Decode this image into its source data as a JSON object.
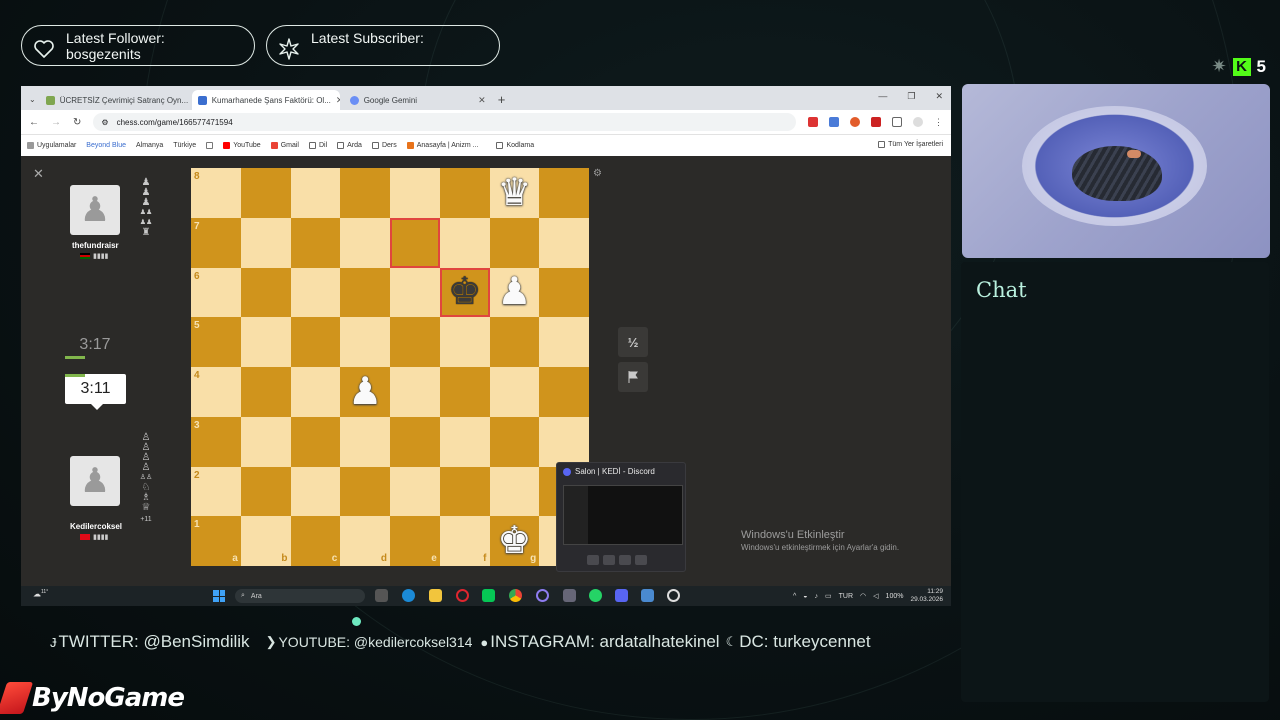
{
  "overlay": {
    "follower_label": "Latest Follower:",
    "follower_name": "bosgezenits",
    "subscriber_label": "Latest Subscriber:",
    "subscriber_name": "",
    "kick_count": "5",
    "chat_title": "Chat",
    "socials": [
      {
        "icon": "twitter-icon",
        "text": "TWITTER: @BenSimdilik"
      },
      {
        "icon": "youtube-icon",
        "text": "YOUTUBE: @kedilercoksel314"
      },
      {
        "icon": "instagram-icon",
        "text": "INSTAGRAM: ardatalhatekinel"
      },
      {
        "icon": "discord-icon",
        "text": "DC: turkeycennet"
      }
    ],
    "sponsor": "ByNoGame",
    "colors": {
      "accent": "#b9f0de",
      "kick_green": "#53fc18",
      "bynogame_red": "#e0261f"
    }
  },
  "browser": {
    "tabs": [
      {
        "label": "ÜCRETSİZ Çevrimiçi Satranç Oyn...",
        "active": false,
        "fav_color": "#7fa650"
      },
      {
        "label": "Kumarhanede Şans Faktörü: Ol...",
        "active": true,
        "fav_color": "#3b6ecf"
      },
      {
        "label": "Google Gemini",
        "active": false,
        "fav_color": "#6a8ef5"
      }
    ],
    "url": "chess.com/game/166577471594",
    "bookmarks": [
      "Uygulamalar",
      "Beyond Blue",
      "Almanya",
      "Türkiye",
      "YouTube",
      "Gmail",
      "Dil",
      "Arda",
      "Ders",
      "Anasayfa | Anizm ...",
      "Kodlama"
    ],
    "bookmarks_right": "Tüm Yer İşaretleri"
  },
  "chess": {
    "top_player": {
      "name": "thefundraisr",
      "rating": "▮▮▮▮",
      "clock": "3:17",
      "captured": [
        "♟",
        "♟",
        "♟",
        "♟♟",
        "♟♟",
        "♜"
      ]
    },
    "bottom_player": {
      "name": "Kedilercoksel",
      "rating": "▮▮▮▮",
      "clock": "3:11",
      "captured": [
        "♙",
        "♙",
        "♙",
        "♙",
        "♙♙",
        "♘",
        "♗",
        "♕"
      ],
      "advantage": "+11"
    },
    "ranks": [
      "8",
      "7",
      "6",
      "5",
      "4",
      "3",
      "2",
      "1"
    ],
    "files": [
      "a",
      "b",
      "c",
      "d",
      "e",
      "f",
      "g",
      "h"
    ],
    "pieces": {
      "g8": "♕w",
      "f6": "♚b",
      "g6": "♙w",
      "d4": "♙w",
      "g1": "♔w"
    },
    "highlights": [
      "e7",
      "f6"
    ],
    "draw_button": "½",
    "resign_icon": "flag-icon"
  },
  "discord_popup": {
    "title": "Salon | KEDİ - Discord"
  },
  "windows": {
    "activation_title": "Windows'u Etkinleştir",
    "activation_sub": "Windows'u etkinleştirmek için Ayarlar'a gidin.",
    "search_placeholder": "Ara",
    "weather": "11°",
    "lang": "TUR",
    "battery": "100%",
    "time": "11:29",
    "date": "29.03.2026"
  }
}
